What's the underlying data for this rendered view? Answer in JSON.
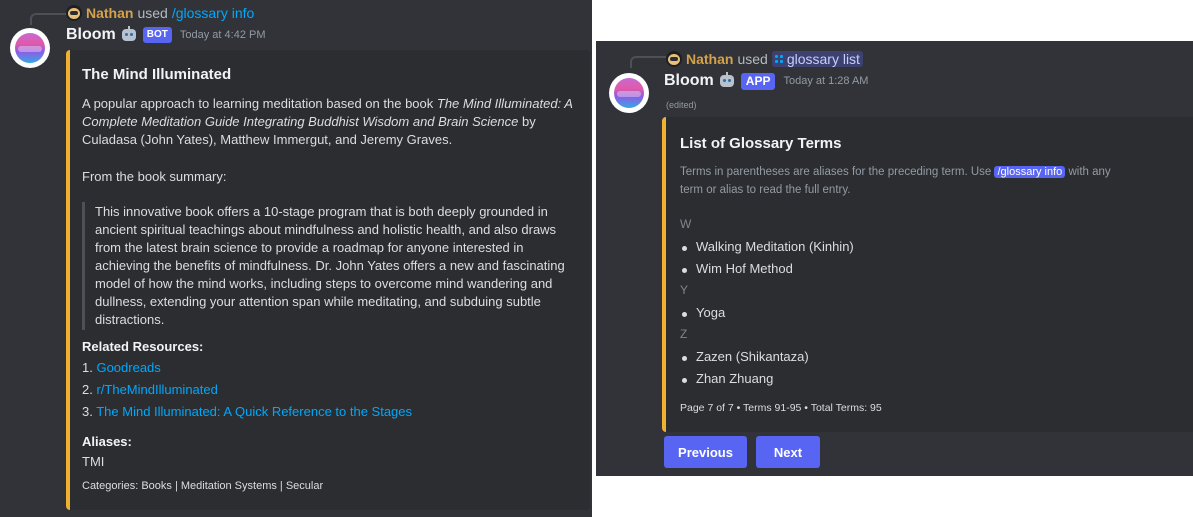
{
  "left": {
    "reply": {
      "user": "Nathan",
      "used": "used",
      "command": "/glossary info"
    },
    "bot": {
      "name": "Bloom",
      "tag": "BOT",
      "timestamp": "Today at 4:42 PM"
    },
    "embed": {
      "title": "The Mind Illuminated",
      "description": {
        "intro": "A popular approach to learning meditation based on the book ",
        "book_title": "The Mind Illuminated: A Complete Meditation Guide Integrating Buddhist Wisdom and Brain Science",
        "outro": " by Culadasa (John Yates), Matthew Immergut, and Jeremy Graves."
      },
      "summary_label": "From the book summary:",
      "quote": "This innovative book offers a 10-stage program that is both deeply grounded in ancient spiritual teachings about mindfulness and holistic health, and also draws from the latest brain science to provide a roadmap for anyone interested in achieving the benefits of mindfulness. Dr. John Yates offers a new and fascinating model of how the mind works, including steps to overcome mind wandering and dullness, extending your attention span while meditating, and subduing subtle distractions.",
      "resources_title": "Related Resources:",
      "resources": [
        {
          "num": "1.",
          "label": "Goodreads"
        },
        {
          "num": "2.",
          "label": "r/TheMindIlluminated"
        },
        {
          "num": "3.",
          "label": "The Mind Illuminated: A Quick Reference to the Stages"
        }
      ],
      "aliases_title": "Aliases:",
      "aliases_value": "TMI",
      "categories_label": "Categories:",
      "categories_value": "Books | Meditation Systems | Secular"
    }
  },
  "right": {
    "reply": {
      "user": "Nathan",
      "used": "used",
      "command": "glossary list"
    },
    "bot": {
      "name": "Bloom",
      "tag": "APP",
      "timestamp": "Today at 1:28 AM",
      "edited": "(edited)"
    },
    "embed": {
      "title": "List of Glossary Terms",
      "desc_before": "Terms in parentheses are aliases for the preceding term. Use ",
      "desc_code": "/glossary info",
      "desc_after_line1": " with any",
      "desc_line2": "term or alias to read the full entry.",
      "groups": [
        {
          "letter": "W",
          "items": [
            "Walking Meditation (Kinhin)",
            "Wim Hof Method"
          ]
        },
        {
          "letter": "Y",
          "items": [
            "Yoga"
          ]
        },
        {
          "letter": "Z",
          "items": [
            "Zazen (Shikantaza)",
            "Zhan Zhuang"
          ]
        }
      ],
      "footer": "Page 7 of 7 • Terms 91-95 • Total Terms: 95"
    },
    "buttons": {
      "previous": "Previous",
      "next": "Next"
    }
  },
  "colors": {
    "background": "#313338",
    "embed_bg": "#2b2d31",
    "accent_bar": "#f0b132",
    "blurple": "#5865f2",
    "link": "#00a8fc"
  }
}
